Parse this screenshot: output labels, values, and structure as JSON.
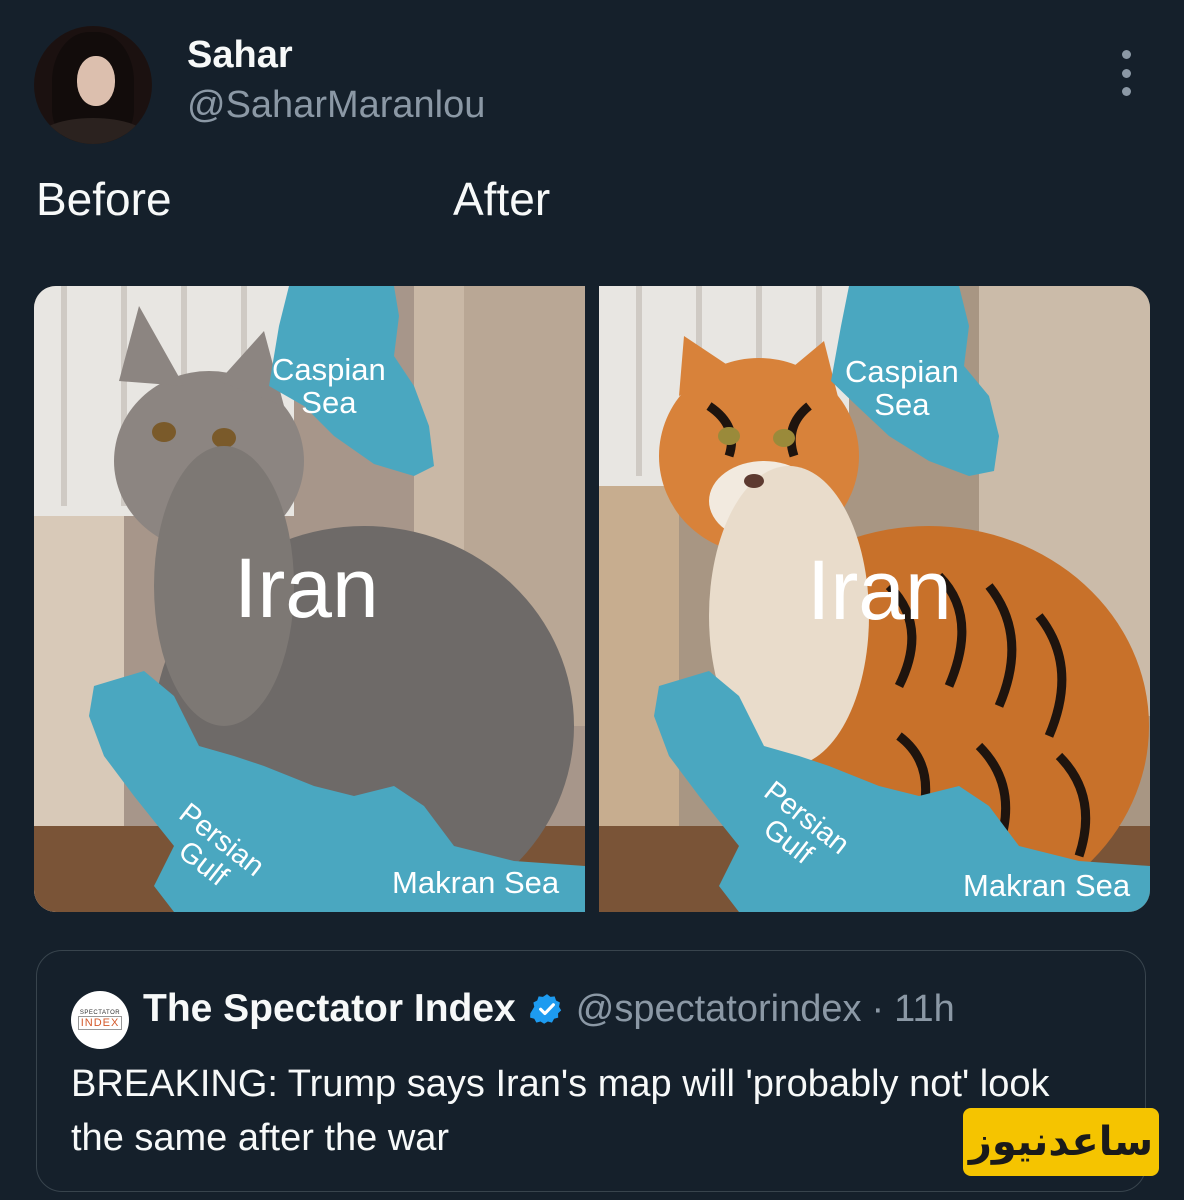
{
  "author": {
    "display_name": "Sahar",
    "handle": "@SaharMaranlou"
  },
  "tweet": {
    "text_left": "Before",
    "text_right": "After"
  },
  "media": {
    "before": {
      "caspian": "Caspian\nSea",
      "country": "Iran",
      "gulf": "Persian\nGulf",
      "makran": "Makran Sea"
    },
    "after": {
      "caspian": "Caspian\nSea",
      "country": "Iran",
      "gulf": "Persian\nGulf",
      "makran": "Makran Sea"
    },
    "colors": {
      "water": "#4aa7c0",
      "cat": "#6e6a68",
      "tiger": "#c8712a"
    }
  },
  "quoted_tweet": {
    "avatar_top": "SPECTATOR",
    "avatar_bottom": "INDEX",
    "name": "The Spectator Index",
    "handle": "@spectatorindex",
    "separator": "·",
    "time": "11h",
    "body": "BREAKING: Trump says Iran's map will 'probably not' look the same after the war"
  },
  "watermark": {
    "text": "ساعدنیوز",
    "color": "#f5c400"
  },
  "icons": {
    "more": "more-options-icon",
    "verified": "verified-badge-icon"
  }
}
